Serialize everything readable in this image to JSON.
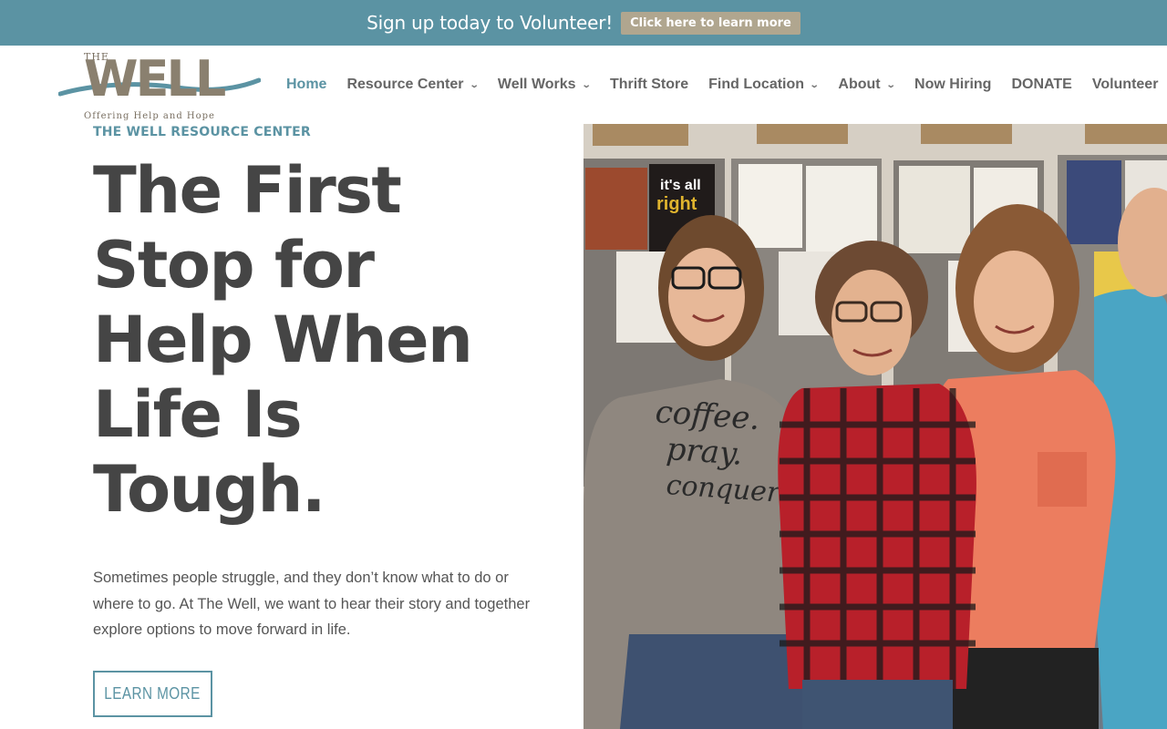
{
  "promo": {
    "text": "Sign up today to Volunteer!",
    "button_label": "Click here to learn more"
  },
  "logo": {
    "top": "THE",
    "main": "WELL",
    "sub": "Offering Help and Hope"
  },
  "nav": {
    "items": [
      {
        "label": "Home",
        "active": true,
        "dropdown": false
      },
      {
        "label": "Resource Center",
        "active": false,
        "dropdown": true
      },
      {
        "label": "Well Works",
        "active": false,
        "dropdown": true
      },
      {
        "label": "Thrift Store",
        "active": false,
        "dropdown": false
      },
      {
        "label": "Find Location",
        "active": false,
        "dropdown": true
      },
      {
        "label": "About",
        "active": false,
        "dropdown": true
      },
      {
        "label": "Now Hiring",
        "active": false,
        "dropdown": false
      },
      {
        "label": "DONATE",
        "active": false,
        "dropdown": false
      },
      {
        "label": "Volunteer",
        "active": false,
        "dropdown": false
      }
    ]
  },
  "hero": {
    "eyebrow": "THE WELL RESOURCE CENTER",
    "headline_lines": [
      "The First",
      "Stop for",
      "Help When",
      "Life Is",
      "Tough."
    ],
    "body": "Sometimes people struggle, and they don’t know what to do or where to go. At The Well, we want to hear their story and together explore options to move forward in life.",
    "cta_label": "LEARN MORE",
    "shirt_text": [
      "coffee.",
      "pray.",
      "conquer"
    ],
    "poster_text": [
      "it's all",
      "right"
    ]
  },
  "colors": {
    "accent": "#5b93a3",
    "promo_button": "#b0a68f",
    "heading": "#454545"
  }
}
